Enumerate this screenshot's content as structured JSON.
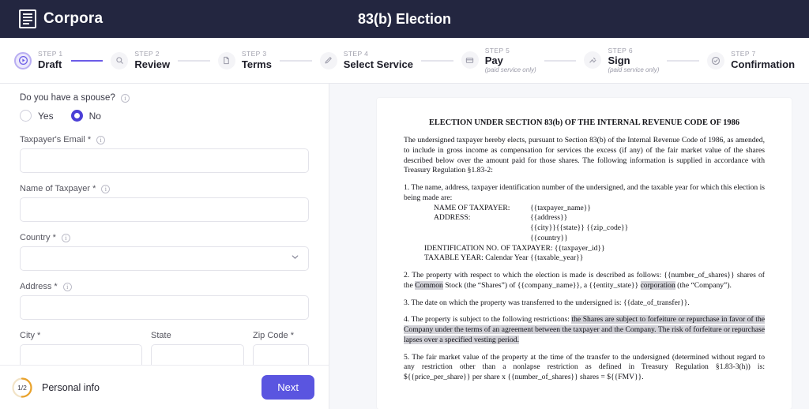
{
  "topbar": {
    "brand": "Corpora",
    "brand_icon": "document-lines-icon",
    "title": "83(b) Election"
  },
  "stepper": {
    "steps": [
      {
        "num": "STEP 1",
        "label": "Draft",
        "note": "",
        "icon": "draft-play-icon",
        "active": true
      },
      {
        "num": "STEP 2",
        "label": "Review",
        "note": "",
        "icon": "search-icon",
        "active": false
      },
      {
        "num": "STEP 3",
        "label": "Terms",
        "note": "",
        "icon": "file-icon",
        "active": false
      },
      {
        "num": "STEP 4",
        "label": "Select Service",
        "note": "",
        "icon": "pencil-icon",
        "active": false
      },
      {
        "num": "STEP 5",
        "label": "Pay",
        "note": "(paid service only)",
        "icon": "card-icon",
        "active": false
      },
      {
        "num": "STEP 6",
        "label": "Sign",
        "note": "(paid service only)",
        "icon": "signature-icon",
        "active": false
      },
      {
        "num": "STEP 7",
        "label": "Confirmation",
        "note": "",
        "icon": "check-circle-icon",
        "active": false
      }
    ]
  },
  "form": {
    "spouse_question": "Do you have a spouse?",
    "radio_yes": "Yes",
    "radio_no": "No",
    "selected_radio": "No",
    "fields": [
      {
        "label": "Taxpayer's Email *",
        "value": "",
        "placeholder": "",
        "type": "text",
        "info": true
      },
      {
        "label": "Name of Taxpayer *",
        "value": "",
        "placeholder": "",
        "type": "text",
        "info": true
      },
      {
        "label": "Country *",
        "value": "",
        "placeholder": "",
        "type": "select",
        "info": true
      },
      {
        "label": "Address *",
        "value": "",
        "placeholder": "",
        "type": "text",
        "info": true
      }
    ],
    "address_row": [
      {
        "label": "City *",
        "value": "",
        "placeholder": ""
      },
      {
        "label": "State",
        "value": "",
        "placeholder": ""
      },
      {
        "label": "Zip Code *",
        "value": "",
        "placeholder": ""
      }
    ]
  },
  "footer": {
    "progress": "1/2",
    "progress_percent": 50,
    "section_label": "Personal info",
    "next_label": "Next",
    "next_color": "#5a55e0",
    "ring_color": "#e9a22b"
  },
  "document": {
    "title": "ELECTION UNDER SECTION 83(b) OF THE INTERNAL REVENUE CODE OF 1986",
    "intro": "The undersigned taxpayer hereby elects, pursuant to Section 83(b) of the Internal Revenue Code of 1986, as amended, to include in gross income as compensation for services the excess (if any) of the fair market value of the shares described below over the amount paid for those shares.  The following information is supplied in accordance with Treasury Regulation §1.83-2:",
    "item1_lead": "1. The name, address, taxpayer identification number of the undersigned, and the taxable year for which this election is being made are:",
    "item1_rows": [
      {
        "key": "NAME OF TAXPAYER:",
        "val": "{{taxpayer_name}}"
      },
      {
        "key": "ADDRESS:",
        "val": "{{address}}"
      },
      {
        "key": "",
        "val": "{{city}}{{state}} {{zip_code}}"
      },
      {
        "key": "",
        "val": "{{country}}"
      }
    ],
    "item1_id": "IDENTIFICATION NO. OF TAXPAYER:  {{taxpayer_id}}",
    "item1_year": "TAXABLE YEAR:  Calendar Year {{taxable_year}}",
    "item2_a": "2.  The property with respect to which the election is made is described as follows: {{number_of_shares}} shares of the ",
    "item2_hl1": "Common",
    "item2_b": " Stock (the “Shares”) of {{company_name}}, a {{entity_state}} ",
    "item2_hl2": "corporation",
    "item2_c": " (the “Company”).",
    "item3": "3. The date on which the property was transferred to the undersigned is: {{date_of_transfer}}.",
    "item4_a": "4. The property is subject to the following restrictions: ",
    "item4_hl": "the Shares are subject to forfeiture or repurchase in favor of the Company under the terms of an agreement between the taxpayer and the Company. The risk of forfeiture or repurchase lapses over a specified vesting period.",
    "item5": "5. The fair market value of the property at the time of the transfer to the undersigned (determined without regard to any restriction other than a nonlapse restriction as defined in Treasury Regulation §1.83-3(h)) is: ${{price_per_share}} per share x {{number_of_shares}} shares = ${{FMV}}."
  }
}
